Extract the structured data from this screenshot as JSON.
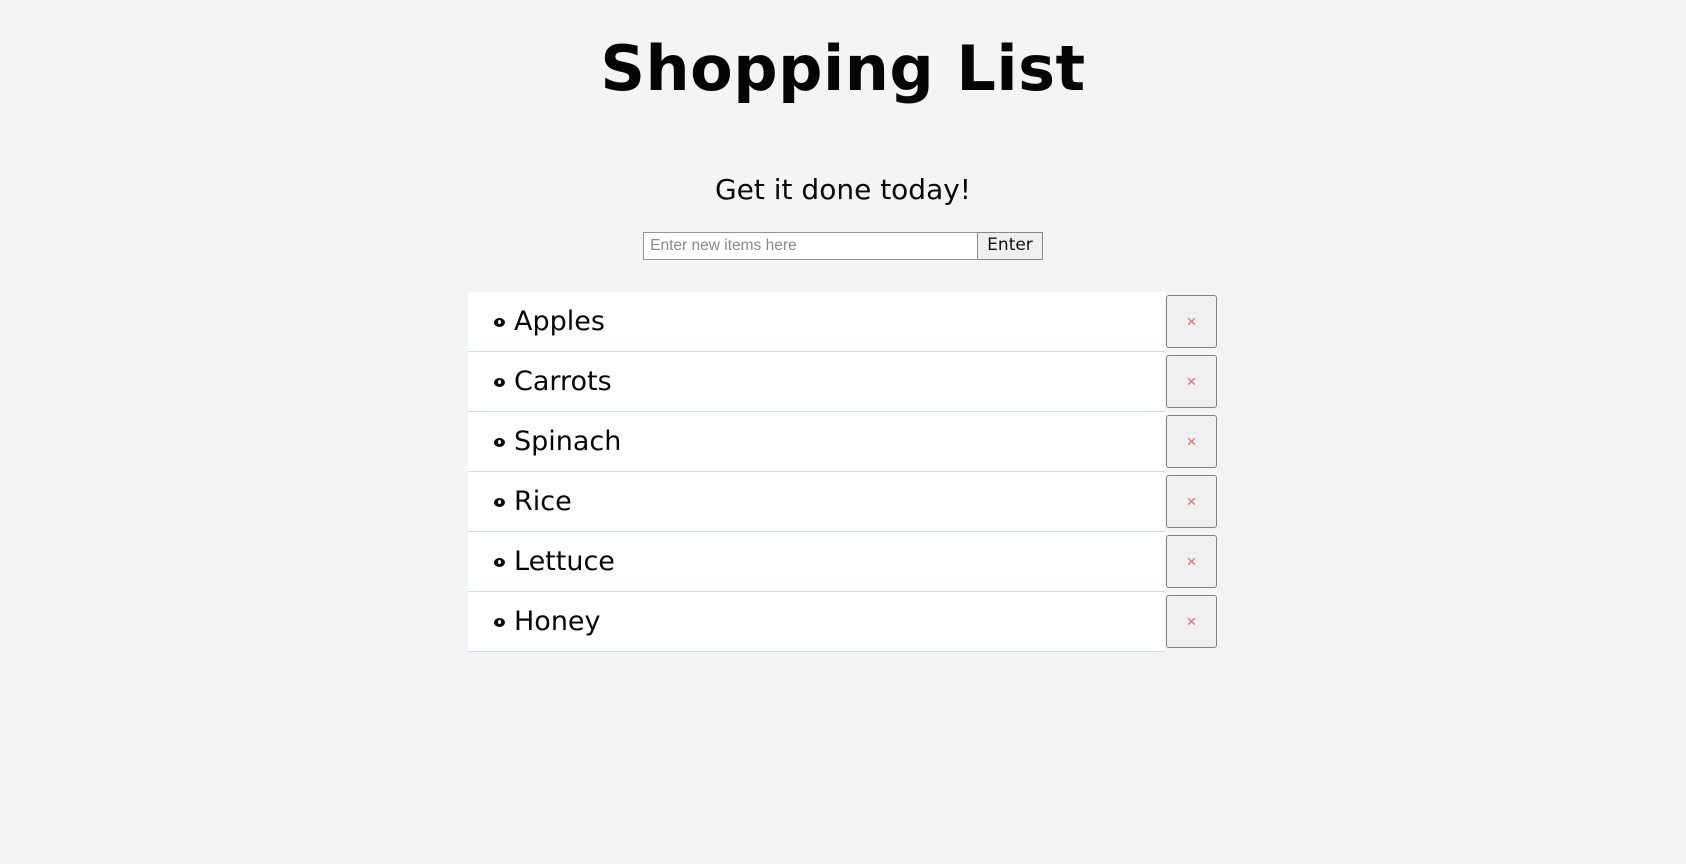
{
  "app": {
    "title": "Shopping List",
    "subtitle": "Get it done today!"
  },
  "entry_form": {
    "placeholder": "Enter new items here",
    "input_value": "",
    "submit_label": "Enter"
  },
  "list": {
    "bullet_icon": "disc-bullet-icon",
    "delete_icon": "close-x-icon",
    "delete_glyph": "×",
    "items": [
      {
        "name": "Apples"
      },
      {
        "name": "Carrots"
      },
      {
        "name": "Spinach"
      },
      {
        "name": "Rice"
      },
      {
        "name": "Lettuce"
      },
      {
        "name": "Honey"
      }
    ]
  },
  "colors": {
    "page_background": "#f4f4f4",
    "row_background": "#ffffff",
    "row_separator": "#cfe0e3",
    "delete_glyph": "#e36a6a",
    "button_background": "#efefef",
    "button_border": "#808080",
    "text": "#070707"
  }
}
